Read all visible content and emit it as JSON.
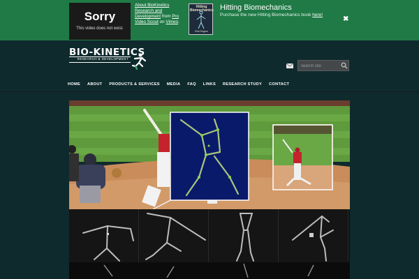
{
  "topbar": {
    "video": {
      "sorry": "Sorry",
      "message": "This video does not exist."
    },
    "video_links": {
      "link1": "About BioKinetics Research and Development",
      "from": "from",
      "link2": "Pro Video Scout",
      "on": "on",
      "link3": "Vimeo",
      "end": "."
    },
    "book": {
      "title": "Hitting Biomechanics",
      "author": "Rob Rogers"
    },
    "promo_heading": "Hitting Biomechanics",
    "promo_text": "Purchase the new Hitting Biomechanics book",
    "promo_link": "here!",
    "close_icon": "close-icon"
  },
  "header": {
    "logo_text": "BIO-KINETICS",
    "logo_sub": "RESEARCH & DEVELOPMENT",
    "mail_icon": "mail-icon",
    "search_placeholder": "search site",
    "search_icon": "search-icon"
  },
  "nav": {
    "items": [
      "HOME",
      "ABOUT",
      "PRODUCTS & SERVICES",
      "MEDIA",
      "FAQ",
      "LINKS",
      "RESEARCH STUDY",
      "CONTACT"
    ]
  },
  "colors": {
    "topbar": "#1f7a45",
    "page": "#0f2a2d",
    "field": "#5f9a3c",
    "dirt": "#c98c5a",
    "skeleton_bg": "#0a1a6b",
    "skeleton": "#8bd44a"
  }
}
